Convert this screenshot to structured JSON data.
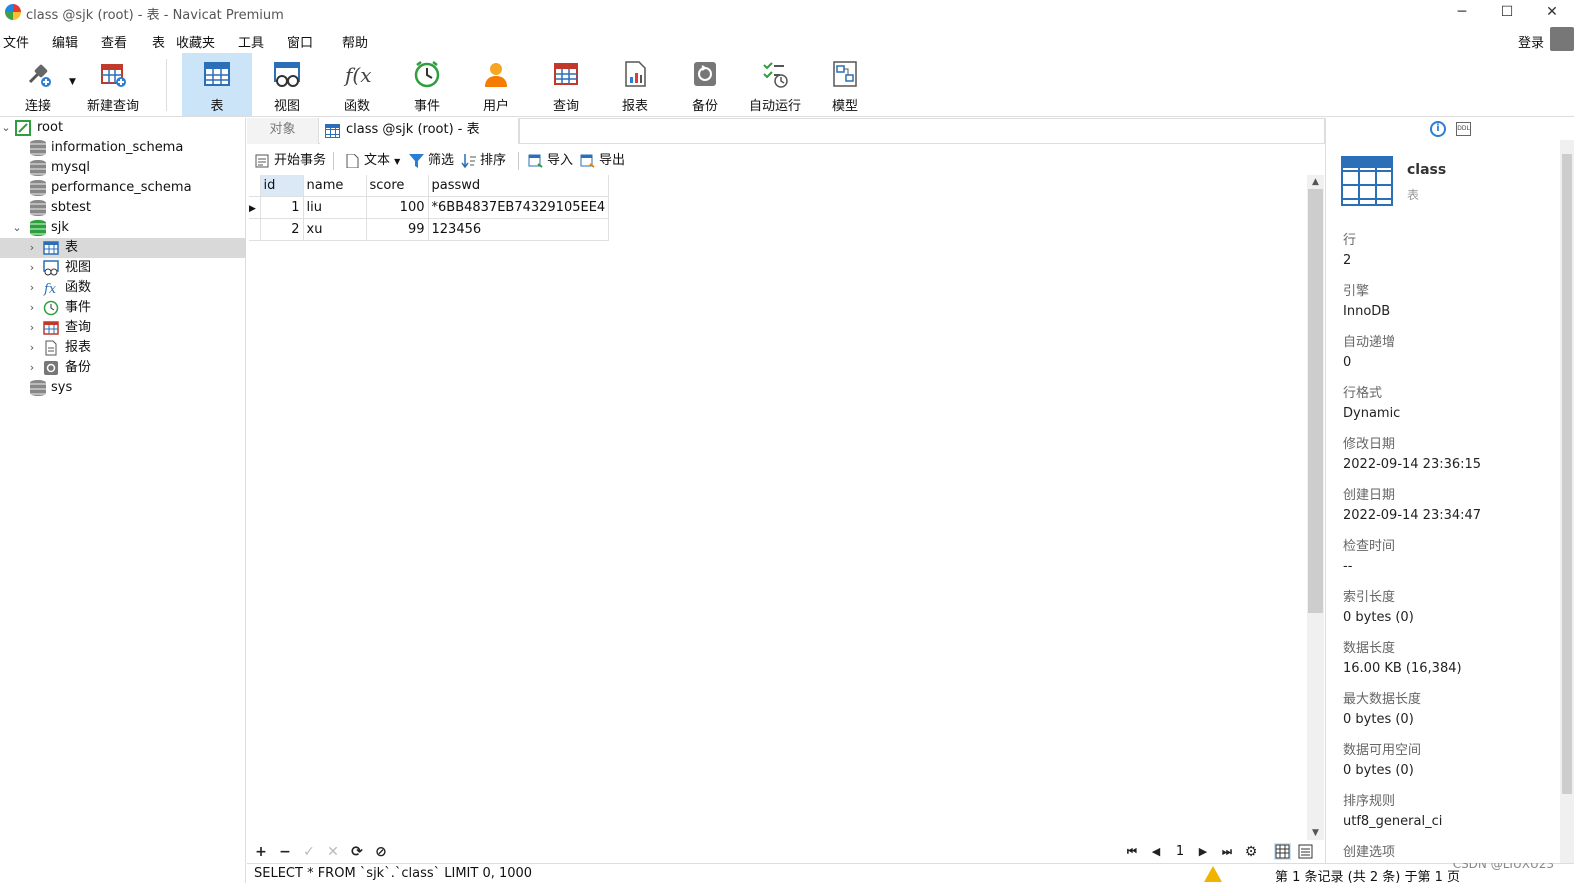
{
  "window": {
    "title": "class @sjk (root) - 表 - Navicat Premium",
    "minimize": "─",
    "maximize": "☐",
    "close": "✕"
  },
  "menu": [
    "文件",
    "编辑",
    "查看",
    "表",
    "收藏夹",
    "工具",
    "窗口",
    "帮助"
  ],
  "login": "登录",
  "toolbar": {
    "connect": "连接",
    "new_query": "新建查询",
    "table": "表",
    "view": "视图",
    "function": "函数",
    "event": "事件",
    "user": "用户",
    "query": "查询",
    "report": "报表",
    "backup": "备份",
    "auto_run": "自动运行",
    "model": "模型"
  },
  "tree": {
    "root": "root",
    "databases": [
      "information_schema",
      "mysql",
      "performance_schema",
      "sbtest",
      "sjk",
      "sys"
    ],
    "sjk_children": [
      "表",
      "视图",
      "函数",
      "事件",
      "查询",
      "报表",
      "备份"
    ]
  },
  "tabs": {
    "objects": "对象",
    "active": "class @sjk (root) - 表"
  },
  "subtoolbar": {
    "begin_tx": "开始事务",
    "text": "文本",
    "filter": "筛选",
    "sort": "排序",
    "import": "导入",
    "export": "导出"
  },
  "grid": {
    "columns": [
      "id",
      "name",
      "score",
      "passwd"
    ],
    "rows": [
      [
        "1",
        "liu",
        "100",
        "*6BB4837EB74329105EE4"
      ],
      [
        "2",
        "xu",
        "99",
        "123456"
      ]
    ]
  },
  "bottombar": {
    "add": "+",
    "remove": "−",
    "apply": "✓",
    "discard": "✕",
    "refresh": "⟳",
    "stop": "⊘",
    "first": "⏮",
    "prev": "◀",
    "page": "1",
    "next": "▶",
    "last": "⏭",
    "settings": "⚙"
  },
  "status": {
    "sql": "SELECT * FROM `sjk`.`class` LIMIT 0, 1000",
    "records": "第 1 条记录 (共 2 条) 于第 1 页"
  },
  "watermark": "CSDN @LIUXU23",
  "info": {
    "name": "class",
    "type": "表",
    "props": [
      {
        "label": "行",
        "value": "2"
      },
      {
        "label": "引擎",
        "value": "InnoDB"
      },
      {
        "label": "自动递增",
        "value": "0"
      },
      {
        "label": "行格式",
        "value": "Dynamic"
      },
      {
        "label": "修改日期",
        "value": "2022-09-14 23:36:15"
      },
      {
        "label": "创建日期",
        "value": "2022-09-14 23:34:47"
      },
      {
        "label": "检查时间",
        "value": "--"
      },
      {
        "label": "索引长度",
        "value": "0 bytes (0)"
      },
      {
        "label": "数据长度",
        "value": "16.00 KB (16,384)"
      },
      {
        "label": "最大数据长度",
        "value": "0 bytes (0)"
      },
      {
        "label": "数据可用空间",
        "value": "0 bytes (0)"
      },
      {
        "label": "排序规则",
        "value": "utf8_general_ci"
      },
      {
        "label": "创建选项",
        "value": ""
      }
    ]
  }
}
